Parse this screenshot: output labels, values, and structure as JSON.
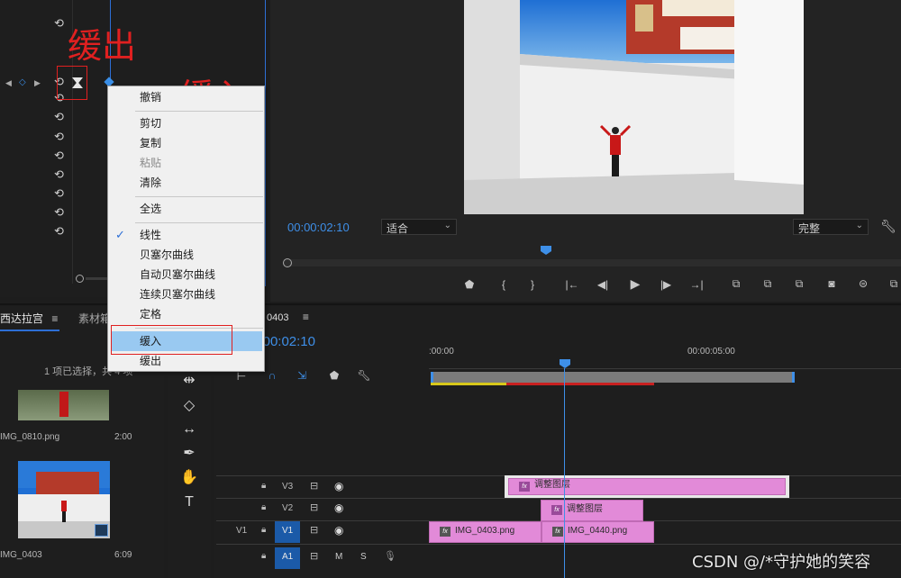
{
  "annotations": {
    "ease_out": "缓出",
    "ease_in": "缓入"
  },
  "context_menu": {
    "items": [
      {
        "label": "撤销",
        "enabled": true
      },
      {
        "label": "剪切",
        "enabled": true
      },
      {
        "label": "复制",
        "enabled": true
      },
      {
        "label": "粘贴",
        "enabled": false
      },
      {
        "label": "清除",
        "enabled": true
      },
      {
        "label": "全选",
        "enabled": true
      },
      {
        "label": "线性",
        "enabled": true,
        "checked": true
      },
      {
        "label": "贝塞尔曲线",
        "enabled": true
      },
      {
        "label": "自动贝塞尔曲线",
        "enabled": true
      },
      {
        "label": "连续贝塞尔曲线",
        "enabled": true
      },
      {
        "label": "定格",
        "enabled": true
      },
      {
        "label": "缓入",
        "enabled": true,
        "highlighted": true
      },
      {
        "label": "缓出",
        "enabled": true
      }
    ]
  },
  "program_monitor": {
    "timecode": "00:00:02:10",
    "fit_value": "适合",
    "quality_value": "完整"
  },
  "project_panel": {
    "tab_active": "西达拉宫",
    "tab_other": "素材箱",
    "selection_status": "1 项已选择，共 4 项",
    "items": [
      {
        "name": "IMG_0810.png",
        "duration": "2:00"
      },
      {
        "name": "IMG_0403",
        "duration": "6:09"
      }
    ]
  },
  "timeline": {
    "sequence_name": "0403",
    "timecode": "00:00:02:10",
    "ruler": [
      ":00:00",
      "00:00:05:00"
    ],
    "tracks": [
      {
        "id": "V3",
        "source": ""
      },
      {
        "id": "V2",
        "source": ""
      },
      {
        "id": "V1",
        "source": "V1"
      },
      {
        "id": "A1",
        "source": "",
        "mute": "M",
        "solo": "S"
      }
    ],
    "clips": [
      {
        "track": "V3",
        "name": "调整图层"
      },
      {
        "track": "V2",
        "name": "调整图层"
      },
      {
        "track": "V1",
        "name": "IMG_0403.png"
      },
      {
        "track": "V1",
        "name": "IMG_0440.png"
      }
    ]
  },
  "watermark": "CSDN @/*守护她的笑容"
}
